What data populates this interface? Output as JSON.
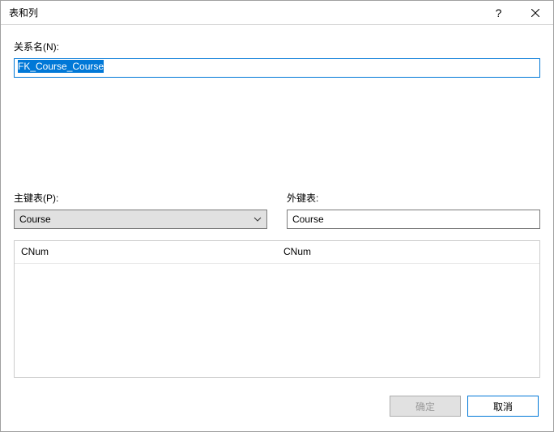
{
  "titlebar": {
    "title": "表和列"
  },
  "labels": {
    "relation_name": "关系名(N):",
    "primary_table": "主键表(P):",
    "foreign_table": "外键表:"
  },
  "fields": {
    "relation_name_value": "FK_Course_Course",
    "primary_table_value": "Course",
    "foreign_table_value": "Course"
  },
  "columns": {
    "primary": [
      "CNum"
    ],
    "foreign": [
      "CNum"
    ]
  },
  "buttons": {
    "ok": "确定",
    "cancel": "取消"
  }
}
